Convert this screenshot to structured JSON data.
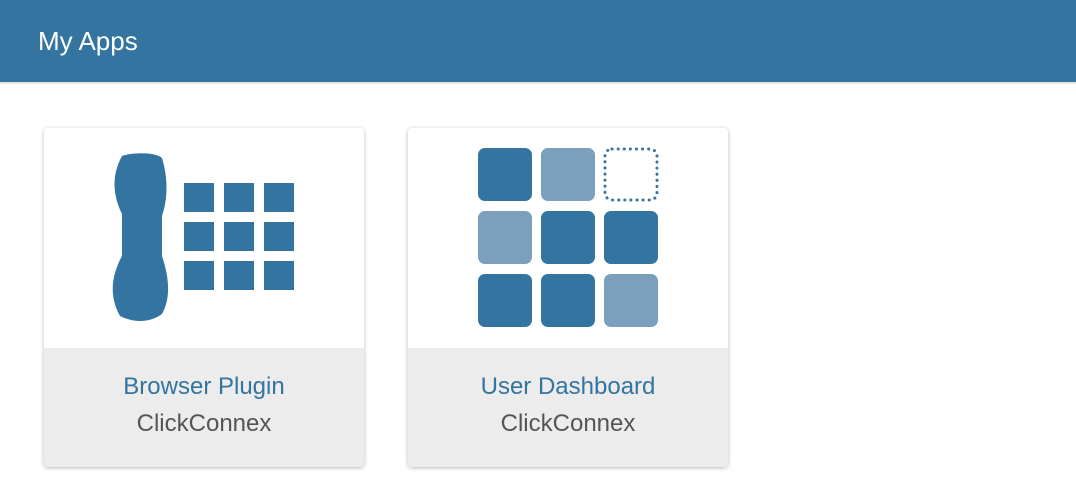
{
  "header": {
    "title": "My Apps",
    "background_color": "#3374a0"
  },
  "apps": [
    {
      "name": "Browser Plugin",
      "vendor": "ClickConnex",
      "icon": "phone-keypad-icon",
      "icon_color": "#3374a0"
    },
    {
      "name": "User Dashboard",
      "vendor": "ClickConnex",
      "icon": "dashboard-grid-icon",
      "icon_color": "#3374a0",
      "icon_light_color": "#7b9fbc"
    }
  ]
}
